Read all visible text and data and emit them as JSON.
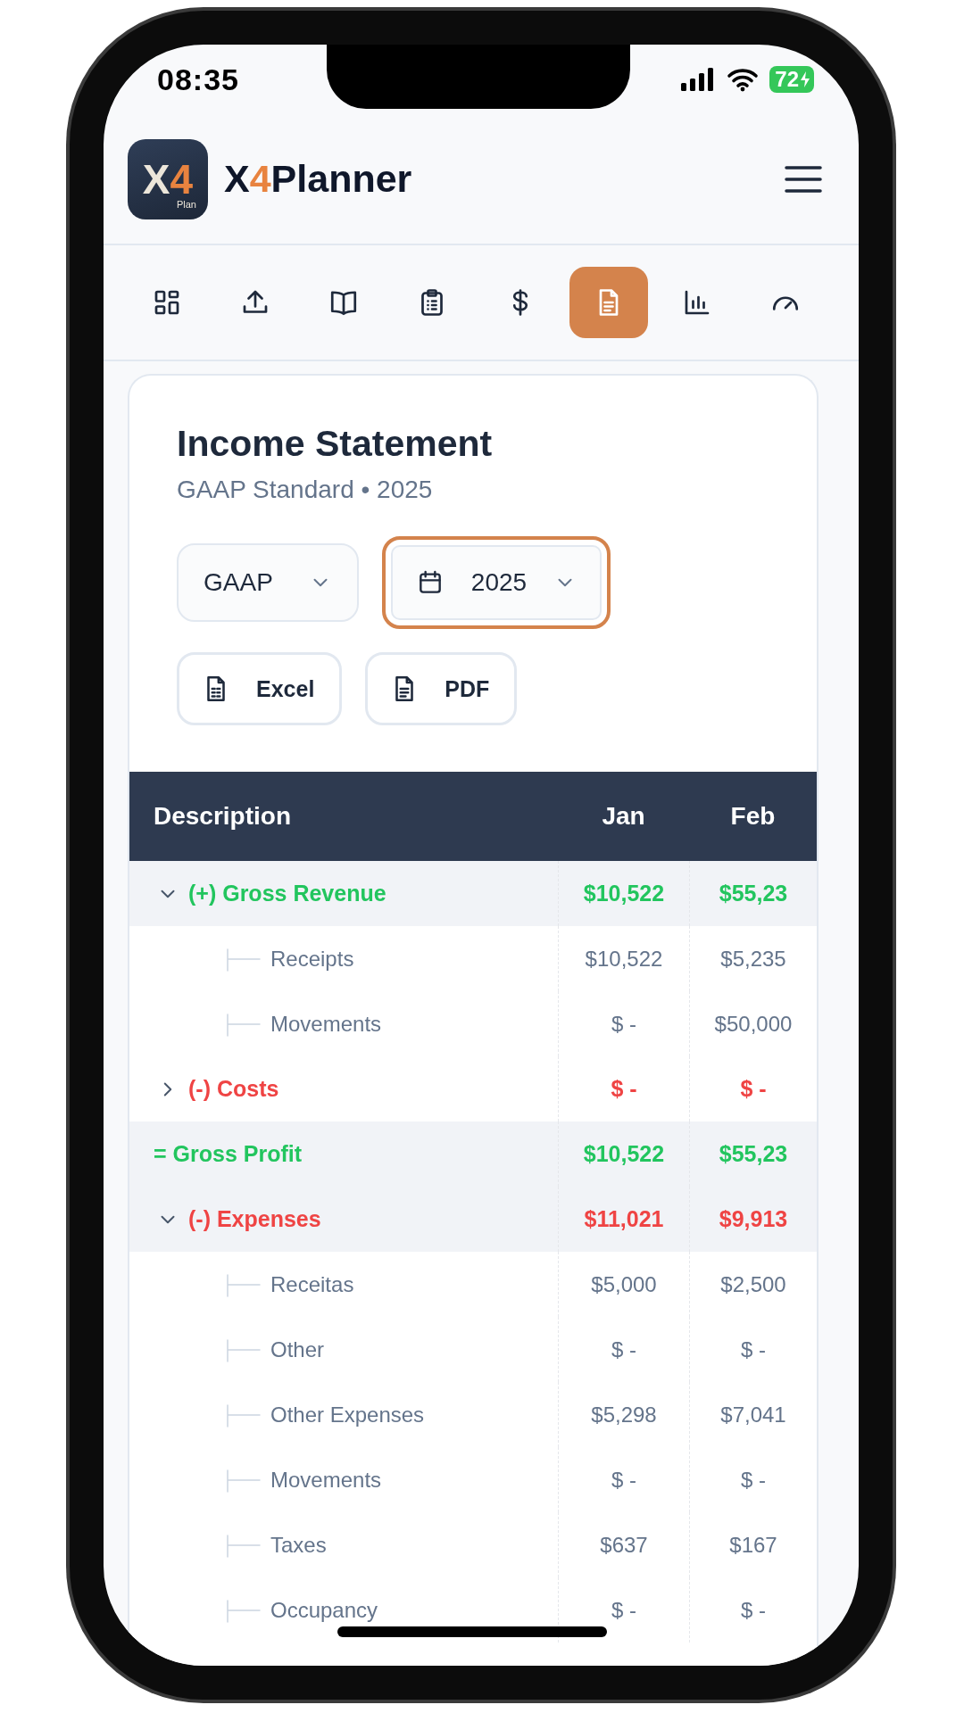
{
  "status_bar": {
    "time": "08:35",
    "battery": "72",
    "charging": true
  },
  "app_bar": {
    "logo_letter": "X",
    "logo_digit": "4",
    "logo_caption": "Plan",
    "brand_prefix": "X",
    "brand_accent": "4",
    "brand_suffix": "Planner"
  },
  "toolbar": [
    {
      "selected": false
    },
    {
      "selected": false
    },
    {
      "selected": false
    },
    {
      "selected": false
    },
    {
      "selected": false
    },
    {
      "selected": true
    },
    {
      "selected": false
    },
    {
      "selected": false
    }
  ],
  "statement": {
    "title": "Income Statement",
    "subtitle": "GAAP Standard • 2025",
    "filters": [
      {
        "kind": "select",
        "value": "GAAP",
        "focused": false
      },
      {
        "kind": "date-select",
        "value": "2025",
        "focused": true
      }
    ],
    "exports": [
      {
        "kind": "spreadsheet",
        "label": "Excel"
      },
      {
        "kind": "document",
        "label": "PDF"
      }
    ]
  },
  "table": {
    "columns": [
      "Description",
      "Jan",
      "Feb"
    ],
    "rows": [
      {
        "kind": "group",
        "color": "#22c55e",
        "label": "(+) Gross Revenue",
        "expanded": true,
        "values": [
          "$10,522",
          "$55,23"
        ],
        "children": [
          {
            "label": "Receipts",
            "values": [
              "$10,522",
              "$5,235"
            ]
          },
          {
            "label": "Movements",
            "values": [
              "$ -",
              "$50,000"
            ]
          }
        ]
      },
      {
        "kind": "group",
        "color": "#ef4444",
        "label": "(-) Costs",
        "expanded": false,
        "values": [
          "$ -",
          "$ -"
        ]
      },
      {
        "kind": "total",
        "color": "#22c55e",
        "label": "= Gross Profit",
        "values": [
          "$10,522",
          "$55,23"
        ]
      },
      {
        "kind": "group",
        "color": "#ef4444",
        "label": "(-) Expenses",
        "expanded": true,
        "values": [
          "$11,021",
          "$9,913"
        ],
        "children": [
          {
            "label": "Receitas",
            "values": [
              "$5,000",
              "$2,500"
            ]
          },
          {
            "label": "Other",
            "values": [
              "$ -",
              "$ -"
            ]
          },
          {
            "label": "Other Expenses",
            "values": [
              "$5,298",
              "$7,041"
            ]
          },
          {
            "label": "Movements",
            "values": [
              "$ -",
              "$ -"
            ]
          },
          {
            "label": "Taxes",
            "values": [
              "$637",
              "$167"
            ]
          },
          {
            "label": "Occupancy",
            "values": [
              "$ -",
              "$ -"
            ]
          }
        ]
      }
    ]
  }
}
